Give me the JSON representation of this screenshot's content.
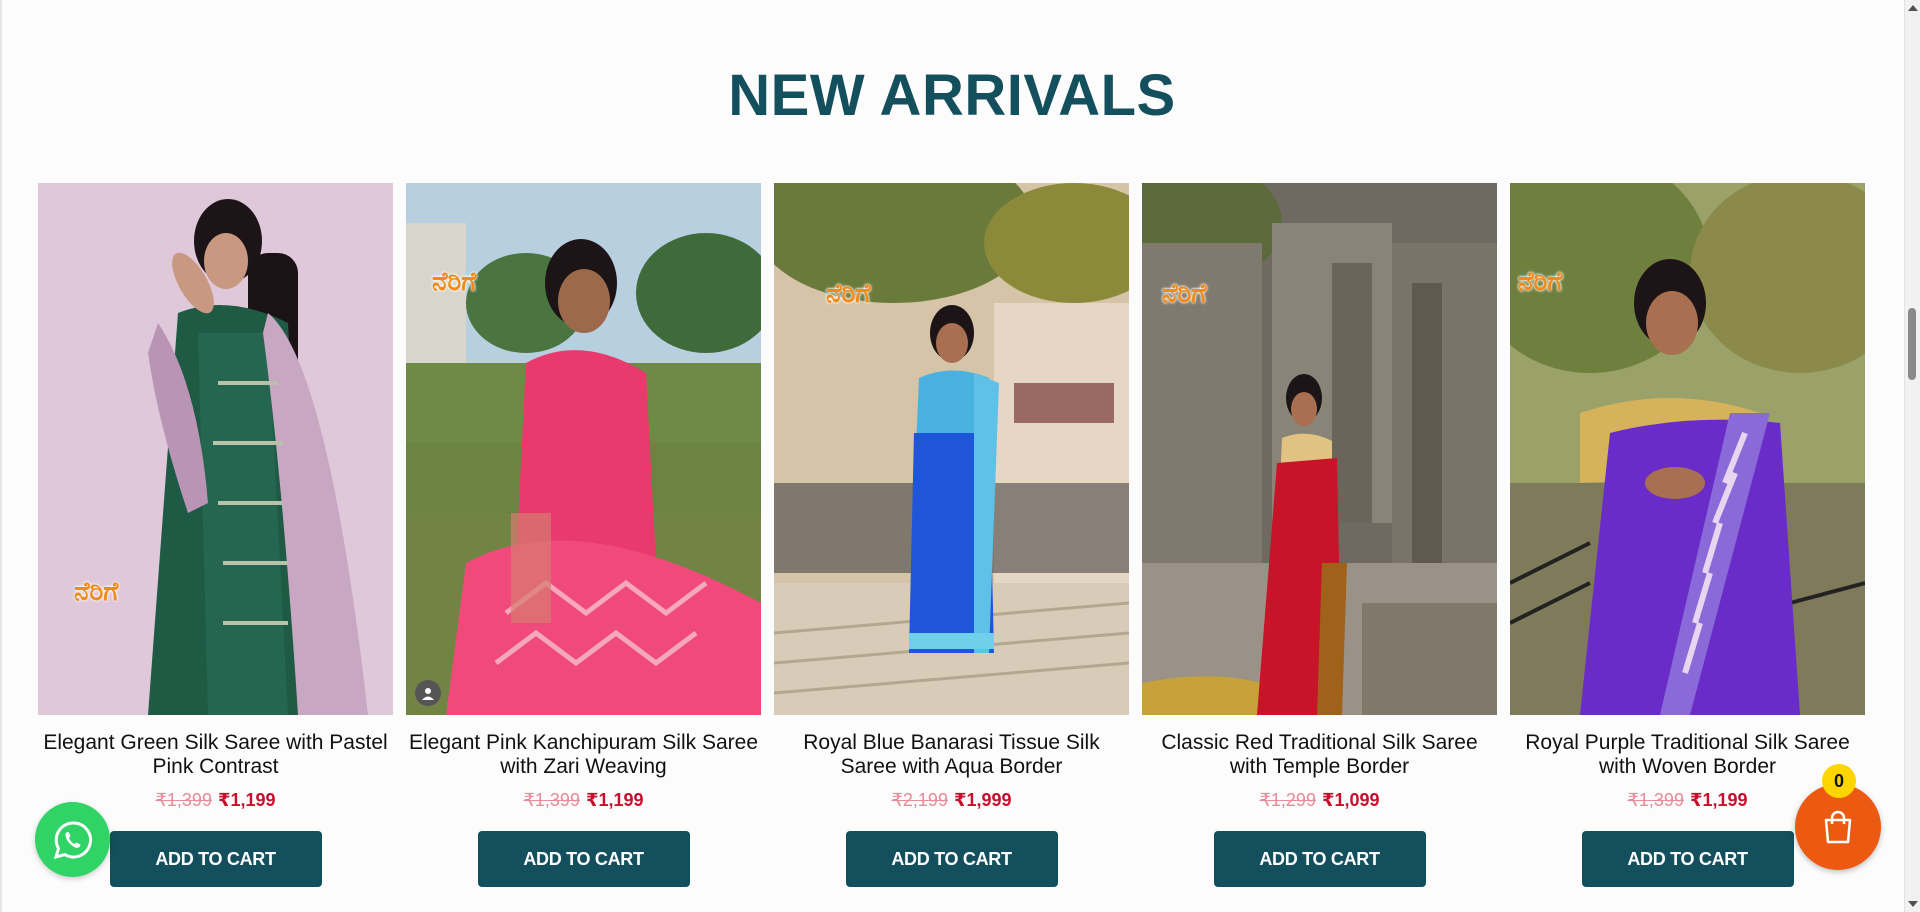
{
  "section": {
    "title": "NEW ARRIVALS"
  },
  "brand": {
    "logo_text": "ನೆರಿಗೆ"
  },
  "products": [
    {
      "name": "Elegant Green Silk Saree with Pastel Pink Contrast",
      "old_price": "₹1,399",
      "new_price": "₹1,199",
      "button_label": "ADD TO CART"
    },
    {
      "name": "Elegant Pink Kanchipuram Silk Saree with Zari Weaving",
      "old_price": "₹1,399",
      "new_price": "₹1,199",
      "button_label": "ADD TO CART"
    },
    {
      "name": "Royal Blue Banarasi Tissue Silk Saree with Aqua Border",
      "old_price": "₹2,199",
      "new_price": "₹1,999",
      "button_label": "ADD TO CART"
    },
    {
      "name": "Classic Red Traditional Silk Saree with Temple Border",
      "old_price": "₹1,299",
      "new_price": "₹1,099",
      "button_label": "ADD TO CART"
    },
    {
      "name": "Royal Purple Traditional Silk Saree with Woven Border",
      "old_price": "₹1,399",
      "new_price": "₹1,199",
      "button_label": "ADD TO CART"
    }
  ],
  "cart": {
    "count": "0",
    "icon": "shopping-bag-icon"
  },
  "whatsapp": {
    "icon": "whatsapp-icon"
  },
  "colors": {
    "accent": "#134f5c",
    "sale_price": "#c8102e",
    "old_price": "#e98a98",
    "cart_fab": "#ec5a11",
    "cart_badge": "#ffd500",
    "whatsapp": "#2fd366"
  }
}
